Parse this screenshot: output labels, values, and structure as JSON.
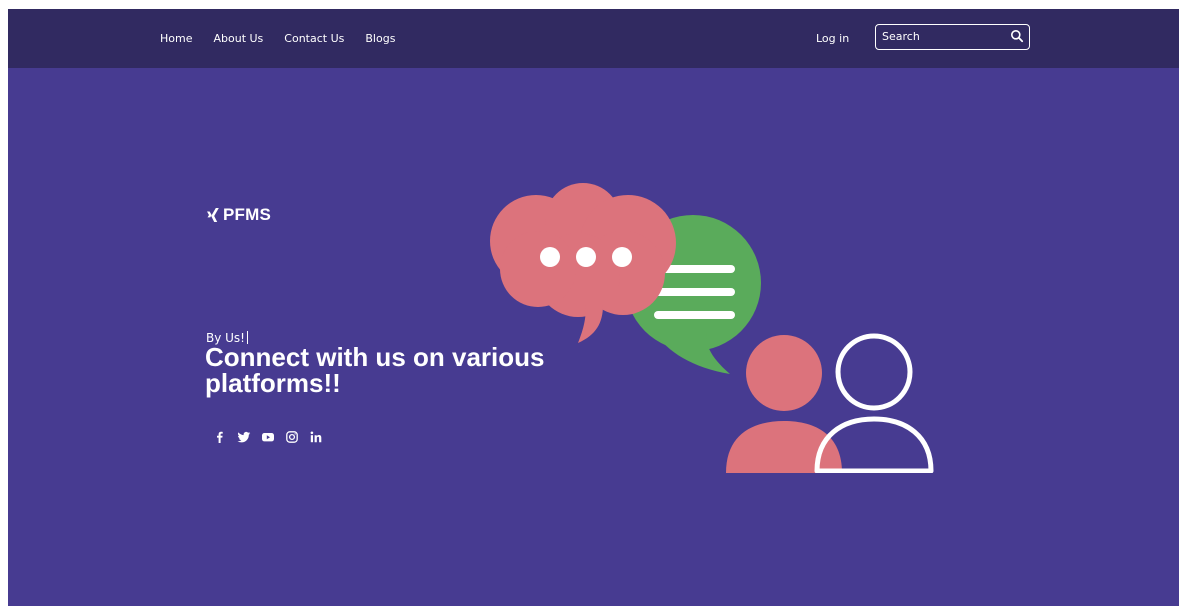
{
  "navbar": {
    "links": [
      {
        "label": "Home"
      },
      {
        "label": "About Us"
      },
      {
        "label": "Contact Us"
      },
      {
        "label": "Blogs"
      }
    ],
    "login_label": "Log in",
    "search": {
      "placeholder": "Search",
      "icon": "search-icon"
    }
  },
  "brand": {
    "name": "PFMS",
    "icon": "xing-logo-icon"
  },
  "hero": {
    "subtitle": "By Us!",
    "headline": "Connect with us on various platforms!!"
  },
  "social": [
    {
      "name": "facebook",
      "icon": "facebook-icon"
    },
    {
      "name": "twitter",
      "icon": "twitter-icon"
    },
    {
      "name": "youtube",
      "icon": "youtube-icon"
    },
    {
      "name": "instagram",
      "icon": "instagram-icon"
    },
    {
      "name": "linkedin",
      "icon": "linkedin-icon"
    }
  ],
  "colors": {
    "page_background": "#473b91",
    "navbar_background": "#312a61",
    "pink_bubble": "#dc737c",
    "green_bubble": "#5aab5b",
    "text": "#ffffff"
  }
}
